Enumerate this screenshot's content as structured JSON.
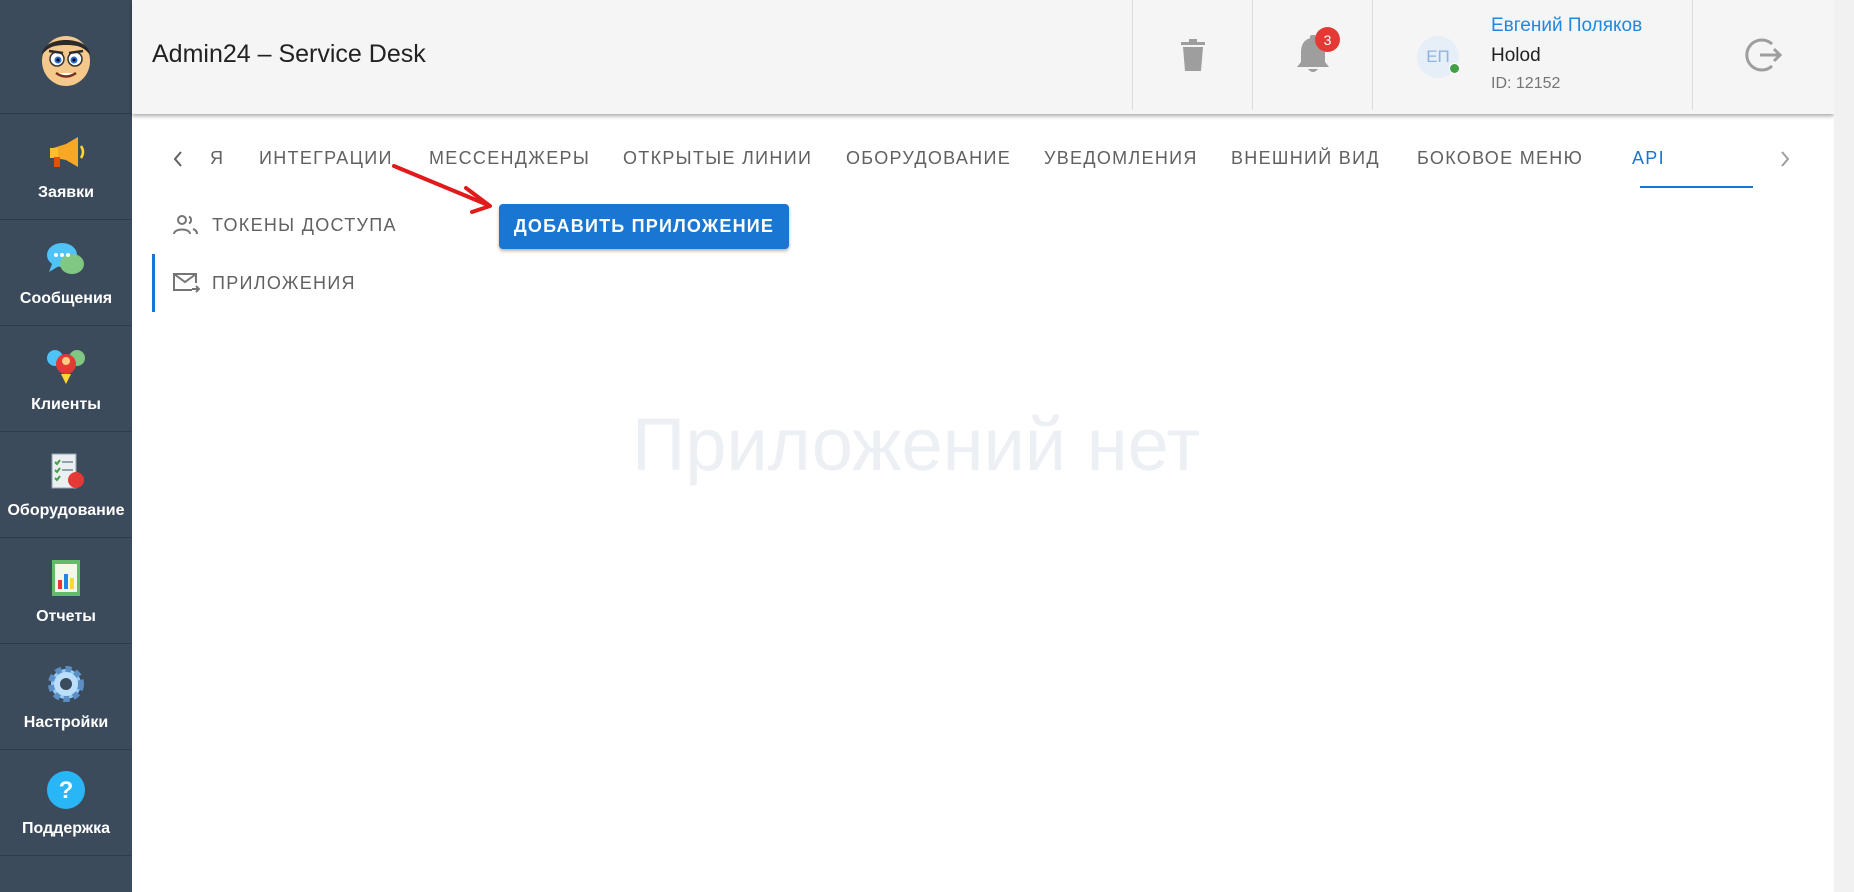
{
  "header": {
    "title": "Admin24 – Service Desk",
    "notification_count": "3",
    "user": {
      "initials": "ЕП",
      "name": "Евгений Поляков",
      "org": "Holod",
      "id": "ID: 12152"
    }
  },
  "sidebar": {
    "items": [
      {
        "label": "Заявки",
        "icon": "megaphone-icon"
      },
      {
        "label": "Сообщения",
        "icon": "chat-bubbles-icon"
      },
      {
        "label": "Клиенты",
        "icon": "clients-icon"
      },
      {
        "label": "Оборудование",
        "icon": "equipment-checklist-icon"
      },
      {
        "label": "Отчеты",
        "icon": "report-chart-icon"
      },
      {
        "label": "Настройки",
        "icon": "gear-icon"
      },
      {
        "label": "Поддержка",
        "icon": "help-question-icon"
      }
    ]
  },
  "tabs": {
    "items": [
      {
        "label": "Я"
      },
      {
        "label": "ИНТЕГРАЦИИ"
      },
      {
        "label": "МЕССЕНДЖЕРЫ"
      },
      {
        "label": "ОТКРЫТЫЕ ЛИНИИ"
      },
      {
        "label": "ОБОРУДОВАНИЕ"
      },
      {
        "label": "УВЕДОМЛЕНИЯ"
      },
      {
        "label": "ВНЕШНИЙ ВИД"
      },
      {
        "label": "БОКОВОЕ МЕНЮ"
      },
      {
        "label": "API"
      }
    ],
    "active": "API"
  },
  "submenu": {
    "items": [
      {
        "label": "ТОКЕНЫ ДОСТУПА",
        "icon": "users-icon"
      },
      {
        "label": "ПРИЛОЖЕНИЯ",
        "icon": "mail-forward-icon"
      }
    ],
    "active": "ПРИЛОЖЕНИЯ"
  },
  "main": {
    "add_button_label": "ДОБАВИТЬ ПРИЛОЖЕНИЕ",
    "empty_text": "Приложений нет"
  },
  "colors": {
    "sidebar_bg": "#3c4b5c",
    "accent": "#1976d2",
    "badge": "#e53935",
    "annotation_arrow": "#e11b1b"
  }
}
